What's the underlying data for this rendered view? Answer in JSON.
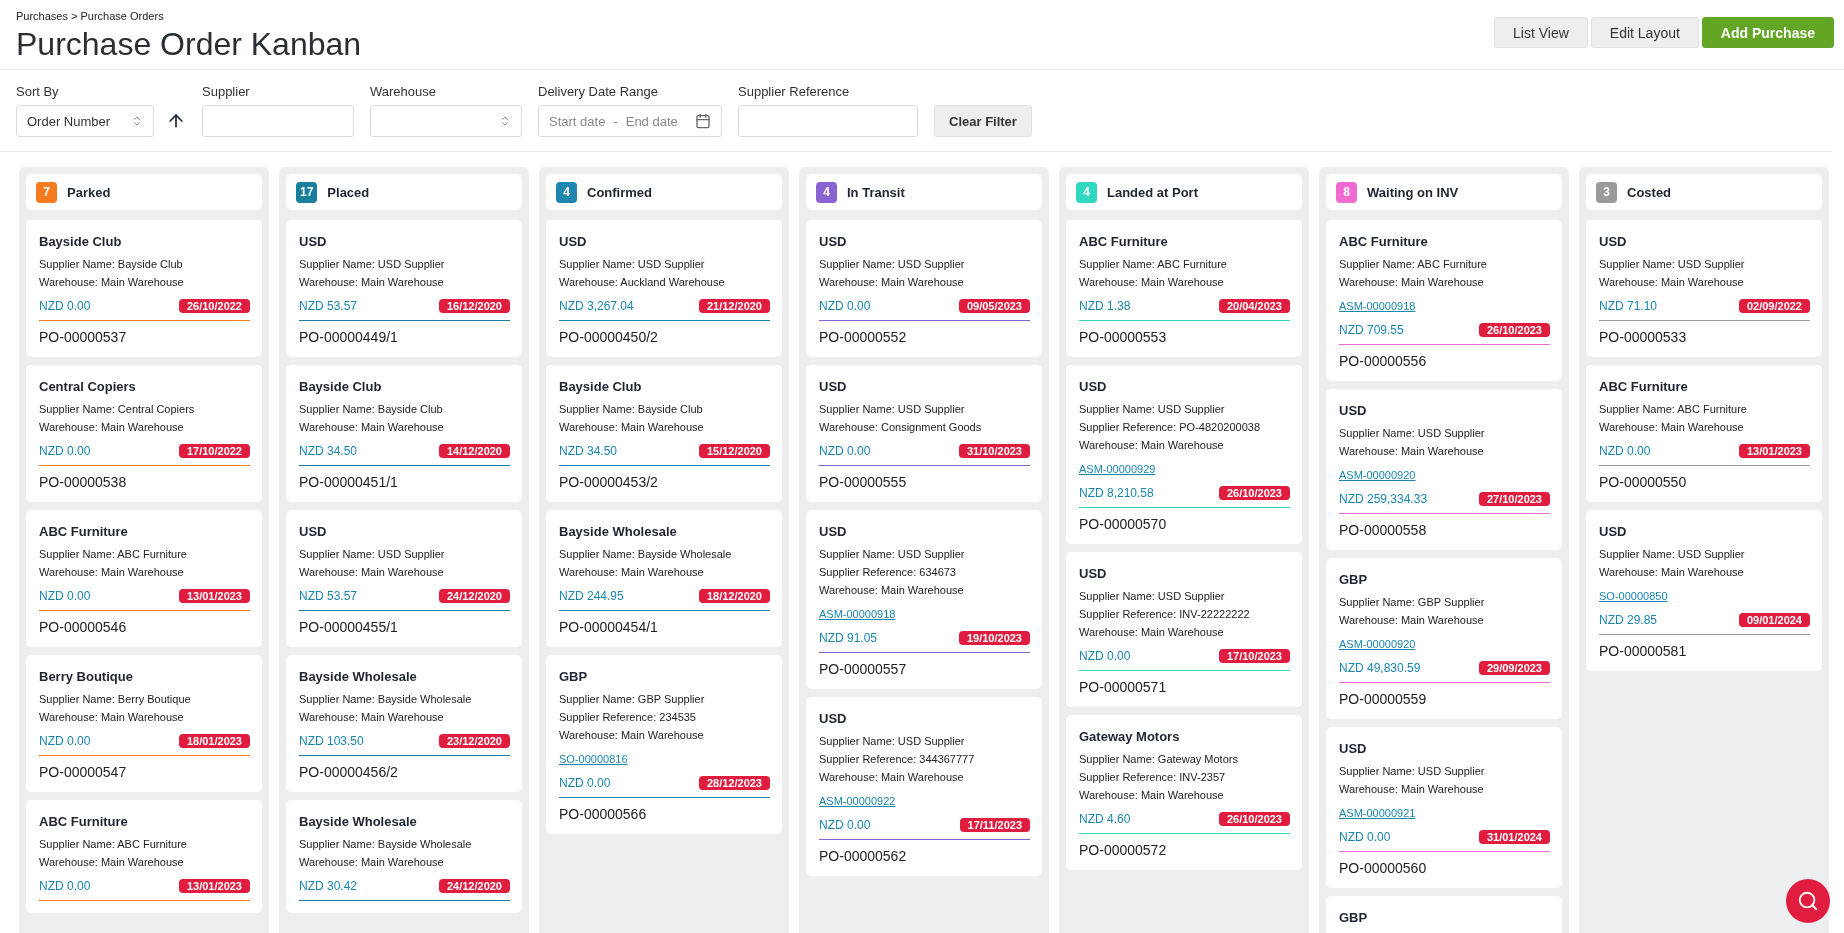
{
  "breadcrumb": "Purchases > Purchase Orders",
  "title": "Purchase Order Kanban",
  "buttons": [
    {
      "label": "List View",
      "kind": "secondary"
    },
    {
      "label": "Edit Layout",
      "kind": "secondary"
    },
    {
      "label": "Add Purchase",
      "kind": "primary"
    }
  ],
  "filters": {
    "sort_by": {
      "label": "Sort By",
      "value": "Order Number"
    },
    "supplier": {
      "label": "Supplier"
    },
    "warehouse": {
      "label": "Warehouse"
    },
    "date_range": {
      "label": "Delivery Date Range",
      "start_placeholder": "Start date",
      "separator": "-",
      "end_placeholder": "End date"
    },
    "supplier_reference": {
      "label": "Supplier Reference"
    },
    "clear_button": "Clear Filter"
  },
  "columns": [
    {
      "title": "Parked",
      "count": "7",
      "color": "#f47b20",
      "cards": [
        {
          "title": "Bayside Club",
          "details": [
            "Supplier Name: Bayside Club",
            "Warehouse: Main Warehouse"
          ],
          "amount": "NZD 0.00",
          "date": "26/10/2022",
          "po": "PO-00000537"
        },
        {
          "title": "Central Copiers",
          "details": [
            "Supplier Name: Central Copiers",
            "Warehouse: Main Warehouse"
          ],
          "amount": "NZD 0.00",
          "date": "17/10/2022",
          "po": "PO-00000538"
        },
        {
          "title": "ABC Furniture",
          "details": [
            "Supplier Name: ABC Furniture",
            "Warehouse: Main Warehouse"
          ],
          "amount": "NZD 0.00",
          "date": "13/01/2023",
          "po": "PO-00000546"
        },
        {
          "title": "Berry Boutique",
          "details": [
            "Supplier Name: Berry Boutique",
            "Warehouse: Main Warehouse"
          ],
          "amount": "NZD 0.00",
          "date": "18/01/2023",
          "po": "PO-00000547"
        },
        {
          "title": "ABC Furniture",
          "details": [
            "Supplier Name: ABC Furniture",
            "Warehouse: Main Warehouse"
          ],
          "amount": "NZD 0.00",
          "date": "13/01/2023"
        }
      ]
    },
    {
      "title": "Placed",
      "count": "17",
      "color": "#1a7f9e",
      "cards": [
        {
          "title": "USD",
          "details": [
            "Supplier Name: USD Supplier",
            "Warehouse: Main Warehouse"
          ],
          "amount": "NZD 53.57",
          "date": "16/12/2020",
          "po": "PO-00000449/1"
        },
        {
          "title": "Bayside Club",
          "details": [
            "Supplier Name: Bayside Club",
            "Warehouse: Main Warehouse"
          ],
          "amount": "NZD 34.50",
          "date": "14/12/2020",
          "po": "PO-00000451/1"
        },
        {
          "title": "USD",
          "details": [
            "Supplier Name: USD Supplier",
            "Warehouse: Main Warehouse"
          ],
          "amount": "NZD 53.57",
          "date": "24/12/2020",
          "po": "PO-00000455/1"
        },
        {
          "title": "Bayside Wholesale",
          "details": [
            "Supplier Name: Bayside Wholesale",
            "Warehouse: Main Warehouse"
          ],
          "amount": "NZD 103.50",
          "date": "23/12/2020",
          "po": "PO-00000456/2"
        },
        {
          "title": "Bayside Wholesale",
          "details": [
            "Supplier Name: Bayside Wholesale",
            "Warehouse: Main Warehouse"
          ],
          "amount": "NZD 30.42",
          "date": "24/12/2020"
        }
      ]
    },
    {
      "title": "Confirmed",
      "count": "4",
      "color": "#1f86b0",
      "cards": [
        {
          "title": "USD",
          "details": [
            "Supplier Name: USD Supplier",
            "Warehouse: Auckland Warehouse"
          ],
          "amount": "NZD 3,267.04",
          "date": "21/12/2020",
          "po": "PO-00000450/2"
        },
        {
          "title": "Bayside Club",
          "details": [
            "Supplier Name: Bayside Club",
            "Warehouse: Main Warehouse"
          ],
          "amount": "NZD 34.50",
          "date": "15/12/2020",
          "po": "PO-00000453/2"
        },
        {
          "title": "Bayside Wholesale",
          "details": [
            "Supplier Name: Bayside Wholesale",
            "Warehouse: Main Warehouse"
          ],
          "amount": "NZD 244.95",
          "date": "18/12/2020",
          "po": "PO-00000454/1"
        },
        {
          "title": "GBP",
          "details": [
            "Supplier Name: GBP Supplier",
            "Supplier Reference: 234535",
            "Warehouse: Main Warehouse"
          ],
          "link": "SO-00000816",
          "amount": "NZD 0.00",
          "date": "28/12/2023",
          "po": "PO-00000566"
        }
      ]
    },
    {
      "title": "In Transit",
      "count": "4",
      "color": "#8a63d2",
      "cards": [
        {
          "title": "USD",
          "details": [
            "Supplier Name: USD Supplier",
            "Warehouse: Main Warehouse"
          ],
          "amount": "NZD 0.00",
          "date": "09/05/2023",
          "po": "PO-00000552"
        },
        {
          "title": "USD",
          "details": [
            "Supplier Name: USD Supplier",
            "Warehouse: Consignment Goods"
          ],
          "amount": "NZD 0.00",
          "date": "31/10/2023",
          "po": "PO-00000555"
        },
        {
          "title": "USD",
          "details": [
            "Supplier Name: USD Supplier",
            "Supplier Reference: 634673",
            "Warehouse: Main Warehouse"
          ],
          "link": "ASM-00000918",
          "amount": "NZD 91.05",
          "date": "19/10/2023",
          "po": "PO-00000557"
        },
        {
          "title": "USD",
          "details": [
            "Supplier Name: USD Supplier",
            "Supplier Reference: 344367777",
            "Warehouse: Main Warehouse"
          ],
          "link": "ASM-00000922",
          "amount": "NZD 0.00",
          "date": "17/11/2023",
          "po": "PO-00000562"
        }
      ]
    },
    {
      "title": "Landed at Port",
      "count": "4",
      "color": "#2ed9bf",
      "cards": [
        {
          "title": "ABC Furniture",
          "details": [
            "Supplier Name: ABC Furniture",
            "Warehouse: Main Warehouse"
          ],
          "amount": "NZD 1.38",
          "date": "20/04/2023",
          "po": "PO-00000553"
        },
        {
          "title": "USD",
          "details": [
            "Supplier Name: USD Supplier",
            "Supplier Reference: PO-4820200038",
            "Warehouse: Main Warehouse"
          ],
          "link": "ASM-00000929",
          "amount": "NZD 8,210.58",
          "date": "26/10/2023",
          "po": "PO-00000570"
        },
        {
          "title": "USD",
          "details": [
            "Supplier Name: USD Supplier",
            "Supplier Reference: INV-22222222",
            "Warehouse: Main Warehouse"
          ],
          "amount": "NZD 0.00",
          "date": "17/10/2023",
          "po": "PO-00000571"
        },
        {
          "title": "Gateway Motors",
          "details": [
            "Supplier Name: Gateway Motors",
            "Supplier Reference: INV-2357",
            "Warehouse: Main Warehouse"
          ],
          "amount": "NZD 4.60",
          "date": "26/10/2023",
          "po": "PO-00000572"
        }
      ]
    },
    {
      "title": "Waiting on INV",
      "count": "8",
      "color": "#f06ad2",
      "cards": [
        {
          "title": "ABC Furniture",
          "details": [
            "Supplier Name: ABC Furniture",
            "Warehouse: Main Warehouse"
          ],
          "link": "ASM-00000918",
          "amount": "NZD 709.55",
          "date": "26/10/2023",
          "po": "PO-00000556"
        },
        {
          "title": "USD",
          "details": [
            "Supplier Name: USD Supplier",
            "Warehouse: Main Warehouse"
          ],
          "link": "ASM-00000920",
          "amount": "NZD 259,334.33",
          "date": "27/10/2023",
          "po": "PO-00000558"
        },
        {
          "title": "GBP",
          "details": [
            "Supplier Name: GBP Supplier",
            "Warehouse: Main Warehouse"
          ],
          "link": "ASM-00000920",
          "amount": "NZD 49,830.59",
          "date": "29/09/2023",
          "po": "PO-00000559"
        },
        {
          "title": "USD",
          "details": [
            "Supplier Name: USD Supplier",
            "Warehouse: Main Warehouse"
          ],
          "link": "ASM-00000921",
          "amount": "NZD 0.00",
          "date": "31/01/2024",
          "po": "PO-00000560"
        },
        {
          "title": "GBP"
        }
      ]
    },
    {
      "title": "Costed",
      "count": "3",
      "color": "#9a9a9a",
      "cards": [
        {
          "title": "USD",
          "details": [
            "Supplier Name: USD Supplier",
            "Warehouse: Main Warehouse"
          ],
          "amount": "NZD 71.10",
          "date": "02/09/2022",
          "po": "PO-00000533"
        },
        {
          "title": "ABC Furniture",
          "details": [
            "Supplier Name: ABC Furniture",
            "Warehouse: Main Warehouse"
          ],
          "amount": "NZD 0.00",
          "date": "13/01/2023",
          "po": "PO-00000550"
        },
        {
          "title": "USD",
          "details": [
            "Supplier Name: USD Supplier",
            "Warehouse: Main Warehouse"
          ],
          "link": "SO-00000850",
          "amount": "NZD 29.85",
          "date": "09/01/2024",
          "po": "PO-00000581"
        }
      ]
    }
  ]
}
